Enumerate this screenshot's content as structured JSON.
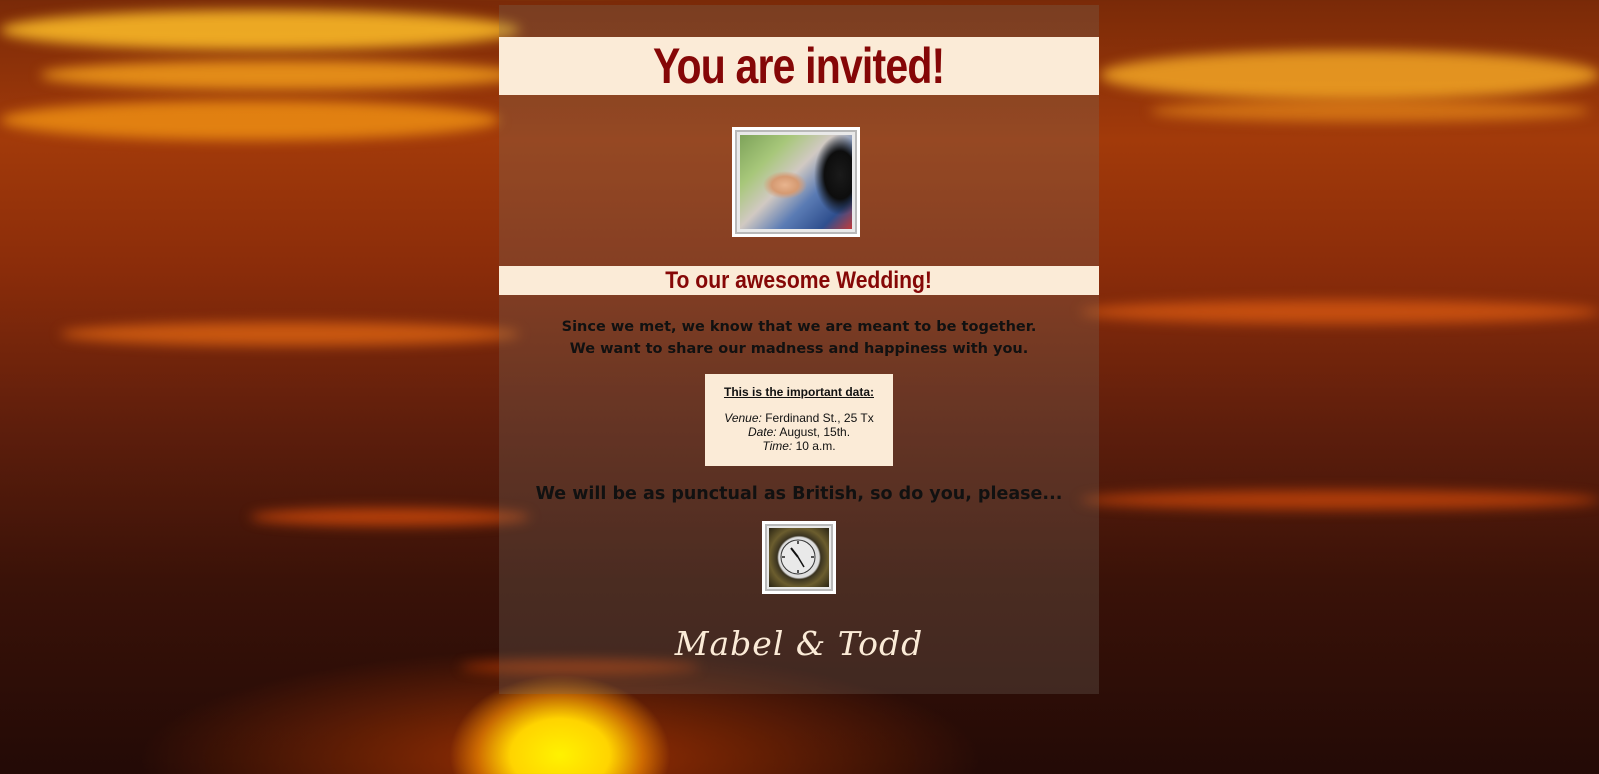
{
  "header": {
    "title": "You are invited!"
  },
  "photo": {
    "alt": "hands-holding-photo"
  },
  "subheader": {
    "title": "To our awesome Wedding!"
  },
  "intro": {
    "line1": "Since we met, we know that we are meant to be together.",
    "line2": "We want to share our madness and happiness with you."
  },
  "details": {
    "heading": "This is the important data:",
    "venue_label": "Venue:",
    "venue_value": "Ferdinand St., 25 Tx",
    "date_label": "Date:",
    "date_value": "August, 15th.",
    "time_label": "Time:",
    "time_value": "10 a.m."
  },
  "punctual": {
    "text": "We will be as punctual as British, so do you, please..."
  },
  "clock": {
    "alt": "big-ben-clock-photo"
  },
  "signature": {
    "text": "Mabel & Todd"
  },
  "colors": {
    "banner_bg": "#fbebd7",
    "title_red": "#850707",
    "signature_cream": "#fbebd7"
  }
}
